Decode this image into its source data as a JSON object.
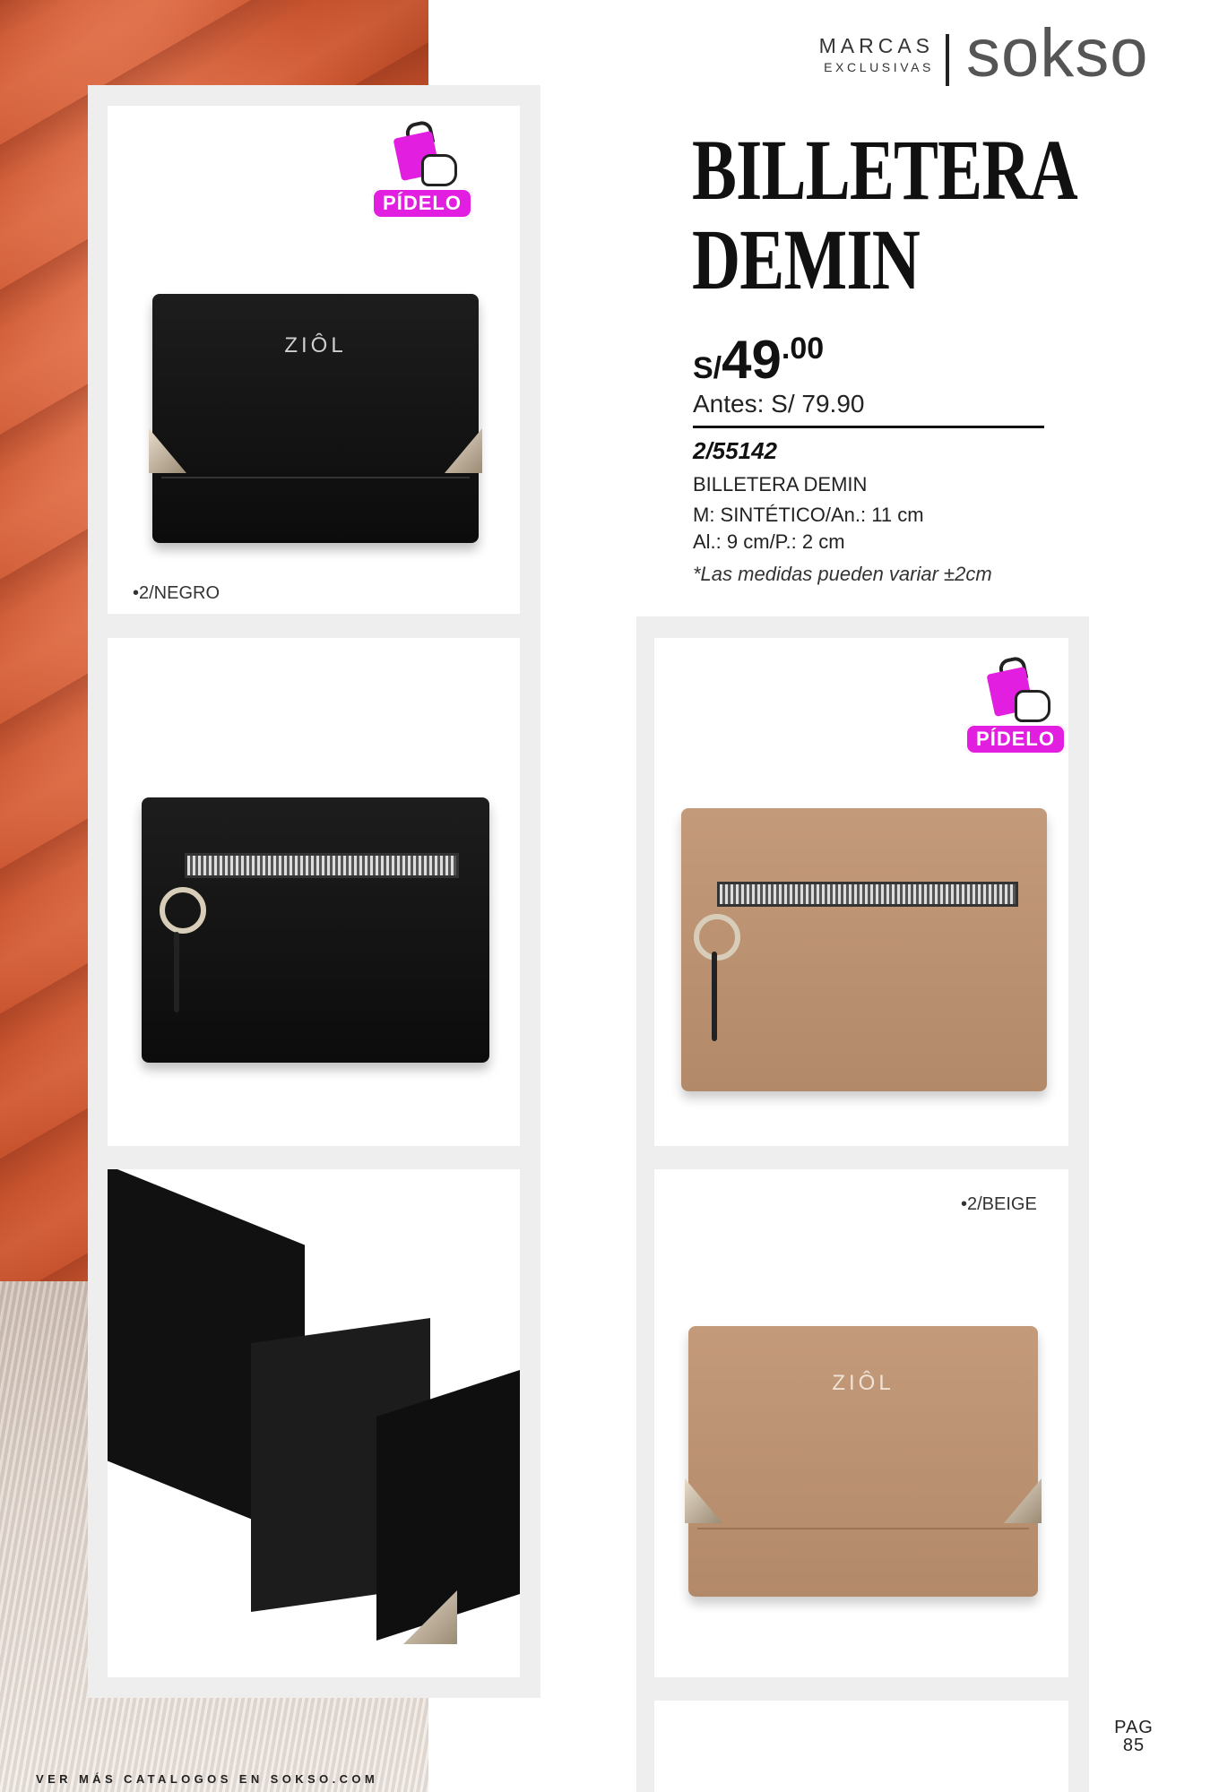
{
  "header": {
    "marcas": "MARCAS",
    "exclusivas": "EXCLUSIVAS",
    "brand": "sokso"
  },
  "product": {
    "title_line1": "BILLETERA",
    "title_line2": "DEMIN",
    "price_currency": "S/",
    "price_int": "49",
    "price_dec": ".00",
    "antes": "Antes: S/ 79.90",
    "code": "2/55142",
    "name": "BILLETERA DEMIN",
    "material": "M: SINTÉTICO/An.: 11 cm",
    "dims": "Al.: 9 cm/P.: 2 cm",
    "note": "*Las medidas pueden variar ±2cm"
  },
  "badges": {
    "pidelo": "PÍDELO"
  },
  "variants": {
    "black": "•2/NEGRO",
    "beige": "•2/BEIGE"
  },
  "wallet": {
    "logo": "ZIÔL"
  },
  "page": {
    "pag_label": "PAG",
    "pag_num": "85"
  },
  "footer": {
    "text": "VER MÁS CATALOGOS EN SOKSO.COM"
  },
  "colors": {
    "accent": "#e21fe0",
    "background_orange": "#c9542f",
    "beige_wallet": "#b38a69"
  }
}
